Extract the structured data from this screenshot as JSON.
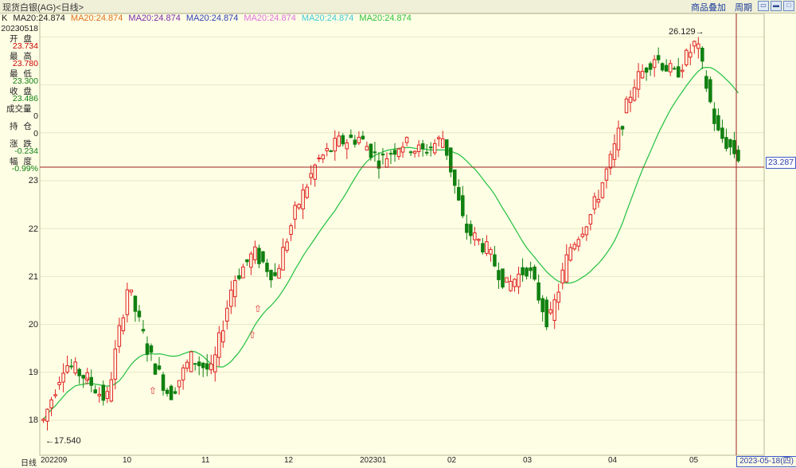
{
  "window": {
    "title": "现货白银(AG)<日线>",
    "menu_overlay": "商品叠加",
    "menu_period": "周期"
  },
  "ma_legend": {
    "prefix": "K",
    "items": [
      {
        "label": "MA20:24.874",
        "color": "#222222"
      },
      {
        "label": "MA20:24.874",
        "color": "#e07020"
      },
      {
        "label": "MA20:24.874",
        "color": "#7a2aa8"
      },
      {
        "label": "MA20:24.874",
        "color": "#3040b8"
      },
      {
        "label": "MA20:24.874",
        "color": "#e070e0"
      },
      {
        "label": "MA20:24.874",
        "color": "#40c8d8"
      },
      {
        "label": "MA20:24.874",
        "color": "#30c040"
      }
    ]
  },
  "info_panel": {
    "date": "20230518",
    "open_label": "开 盘",
    "open": "23.734",
    "high_label": "最 高",
    "high": "23.780",
    "low_label": "最 低",
    "low": "23.300",
    "close_label": "收 盘",
    "close": "23.486",
    "volume_label": "成交量",
    "volume": "0",
    "oi_label": "持 仓",
    "oi": "0",
    "change_label": "涨 跌",
    "change": "-0.234",
    "pct_label": "幅 度",
    "pct": "-0.99%"
  },
  "axis": {
    "period_label": "日线",
    "y_ticks": [
      "23",
      "22",
      "21",
      "20",
      "19",
      "18"
    ],
    "x_ticks": [
      "202209",
      "10",
      "11",
      "12",
      "202301",
      "02",
      "03",
      "04",
      "05"
    ]
  },
  "annotations": {
    "high_marker": "26.129",
    "low_marker": "17.540",
    "current_price": "23.287",
    "cursor_date": "2023-05-18(四)"
  },
  "colors": {
    "up": "#e02020",
    "down": "#108010",
    "ma": "#20c040",
    "cursor": "#a02020",
    "background": "#fefee4"
  },
  "chart_data": {
    "type": "candlestick",
    "ylim": [
      17.5,
      26.5
    ],
    "ma_period": 20,
    "high": 26.129,
    "low": 17.54,
    "waypoints": [
      {
        "x": "202209",
        "v": 18.0
      },
      {
        "x": "202209",
        "v": 19.2
      },
      {
        "x": "202209",
        "v": 18.9
      },
      {
        "x": "10",
        "v": 18.4
      },
      {
        "x": "10",
        "v": 20.8
      },
      {
        "x": "10",
        "v": 19.4
      },
      {
        "x": "11",
        "v": 18.5
      },
      {
        "x": "11",
        "v": 19.3
      },
      {
        "x": "11",
        "v": 19.0
      },
      {
        "x": "11",
        "v": 20.9
      },
      {
        "x": "11",
        "v": 21.5
      },
      {
        "x": "12",
        "v": 21.0
      },
      {
        "x": "12",
        "v": 22.4
      },
      {
        "x": "12",
        "v": 23.4
      },
      {
        "x": "12",
        "v": 23.8
      },
      {
        "x": "202301",
        "v": 23.9
      },
      {
        "x": "202301",
        "v": 23.4
      },
      {
        "x": "202301",
        "v": 23.8
      },
      {
        "x": "02",
        "v": 23.6
      },
      {
        "x": "02",
        "v": 23.9
      },
      {
        "x": "02",
        "v": 22.0
      },
      {
        "x": "02",
        "v": 21.6
      },
      {
        "x": "03",
        "v": 20.8
      },
      {
        "x": "03",
        "v": 21.2
      },
      {
        "x": "03",
        "v": 20.0
      },
      {
        "x": "03",
        "v": 21.6
      },
      {
        "x": "04",
        "v": 22.3
      },
      {
        "x": "04",
        "v": 23.5
      },
      {
        "x": "04",
        "v": 25.0
      },
      {
        "x": "04",
        "v": 25.6
      },
      {
        "x": "05",
        "v": 25.2
      },
      {
        "x": "05",
        "v": 25.9
      },
      {
        "x": "05",
        "v": 24.0
      },
      {
        "x": "05",
        "v": 23.5
      }
    ]
  }
}
